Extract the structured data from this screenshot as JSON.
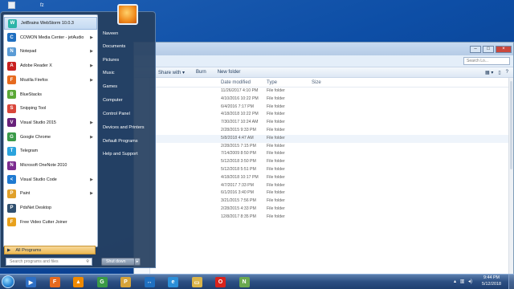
{
  "desktop": {
    "icon_labels": [
      "fz"
    ]
  },
  "explorer": {
    "search_placeholder": "Search Lo...",
    "toolbar": [
      "Share with ▾",
      "Burn",
      "New folder"
    ],
    "columns": {
      "date": "Date modified",
      "type": "Type",
      "size": "Size"
    },
    "rows": [
      {
        "date": "11/26/2017 4:10 PM",
        "type": "File folder"
      },
      {
        "date": "4/10/2016 10:22 PM",
        "type": "File folder"
      },
      {
        "date": "6/4/2016 7:17 PM",
        "type": "File folder"
      },
      {
        "date": "4/18/2018 10:22 PM",
        "type": "File folder"
      },
      {
        "date": "7/30/2017 10:24 AM",
        "type": "File folder"
      },
      {
        "date": "2/28/2015 9:33 PM",
        "type": "File folder"
      },
      {
        "date": "5/8/2018 4:47 AM",
        "type": "File folder"
      },
      {
        "date": "2/28/2015 7:15 PM",
        "type": "File folder"
      },
      {
        "date": "7/14/2009 8:50 PM",
        "type": "File folder"
      },
      {
        "date": "5/12/2018 3:50 PM",
        "type": "File folder"
      },
      {
        "date": "5/12/2018 5:51 PM",
        "type": "File folder"
      },
      {
        "date": "4/18/2018 10:17 PM",
        "type": "File folder"
      },
      {
        "date": "4/7/2017 7:33 PM",
        "type": "File folder"
      },
      {
        "date": "6/1/2016 3:40 PM",
        "type": "File folder"
      },
      {
        "date": "3/21/2015 7:56 PM",
        "type": "File folder"
      },
      {
        "date": "2/28/2015 4:33 PM",
        "type": "File folder"
      },
      {
        "date": "12/8/2017 8:35 PM",
        "type": "File folder"
      }
    ]
  },
  "start_menu": {
    "programs": [
      {
        "label": "JetBrains WebStorm 10.0.3",
        "icon": "webstorm-icon",
        "color": "#2db4a8",
        "glyph": "W",
        "arrow": false
      },
      {
        "label": "COWON Media Center - jetAudio",
        "icon": "jetaudio-icon",
        "color": "#1f6fc0",
        "glyph": "C",
        "arrow": true
      },
      {
        "label": "Notepad",
        "icon": "notepad-icon",
        "color": "#5a9bd5",
        "glyph": "N",
        "arrow": true
      },
      {
        "label": "Adobe Reader X",
        "icon": "adobe-reader-icon",
        "color": "#c8201f",
        "glyph": "A",
        "arrow": true
      },
      {
        "label": "Mozilla Firefox",
        "icon": "firefox-icon",
        "color": "#e66a1f",
        "glyph": "F",
        "arrow": true
      },
      {
        "label": "BlueStacks",
        "icon": "bluestacks-icon",
        "color": "#5ba836",
        "glyph": "B",
        "arrow": false
      },
      {
        "label": "Snipping Tool",
        "icon": "snipping-tool-icon",
        "color": "#d9463a",
        "glyph": "S",
        "arrow": false
      },
      {
        "label": "Visual Studio 2015",
        "icon": "visual-studio-icon",
        "color": "#68217a",
        "glyph": "V",
        "arrow": true
      },
      {
        "label": "Google Chrome",
        "icon": "chrome-icon",
        "color": "#3a9a48",
        "glyph": "G",
        "arrow": true
      },
      {
        "label": "Telegram",
        "icon": "telegram-icon",
        "color": "#2aa3dd",
        "glyph": "T",
        "arrow": false
      },
      {
        "label": "Microsoft OneNote 2010",
        "icon": "onenote-icon",
        "color": "#7b2b8f",
        "glyph": "N",
        "arrow": false
      },
      {
        "label": "Visual Studio Code",
        "icon": "vscode-icon",
        "color": "#1f7ad1",
        "glyph": "<",
        "arrow": true
      },
      {
        "label": "Paint",
        "icon": "paint-icon",
        "color": "#e0a02a",
        "glyph": "P",
        "arrow": true
      },
      {
        "label": "PdsNet Desktop",
        "icon": "pdsnet-icon",
        "color": "#2f4f6f",
        "glyph": "P",
        "arrow": false
      },
      {
        "label": "Free Video Cutter Joiner",
        "icon": "video-cutter-icon",
        "color": "#e8a11c",
        "glyph": "F",
        "arrow": false
      }
    ],
    "all_programs": "All Programs",
    "search_placeholder": "Search programs and files",
    "right_items": [
      "Naveen",
      "Documents",
      "Pictures",
      "Music",
      "Games",
      "Computer",
      "Control Panel",
      "Devices and Printers",
      "Default Programs",
      "Help and Support"
    ],
    "shutdown": "Shut down"
  },
  "taskbar": {
    "apps": [
      {
        "icon": "media-player-icon",
        "color": "#2e6fc4",
        "glyph": "▶"
      },
      {
        "icon": "firefox-icon",
        "color": "#e66a1f",
        "glyph": "F"
      },
      {
        "icon": "vlc-icon",
        "color": "#f08a00",
        "glyph": "▲"
      },
      {
        "icon": "chrome-icon",
        "color": "#3a9a48",
        "glyph": "G"
      },
      {
        "icon": "paint-icon",
        "color": "#d5a33a",
        "glyph": "P"
      },
      {
        "icon": "teamviewer-icon",
        "color": "#1f6fc0",
        "glyph": "↔"
      },
      {
        "icon": "internet-explorer-icon",
        "color": "#2b8fd9",
        "glyph": "e"
      },
      {
        "icon": "file-explorer-icon",
        "color": "#d9b44a",
        "glyph": "▭"
      },
      {
        "icon": "opera-icon",
        "color": "#d9231c",
        "glyph": "O"
      },
      {
        "icon": "notepad-plus-icon",
        "color": "#6aa84f",
        "glyph": "N"
      }
    ],
    "time": "9:44 PM",
    "date": "5/12/2018"
  }
}
